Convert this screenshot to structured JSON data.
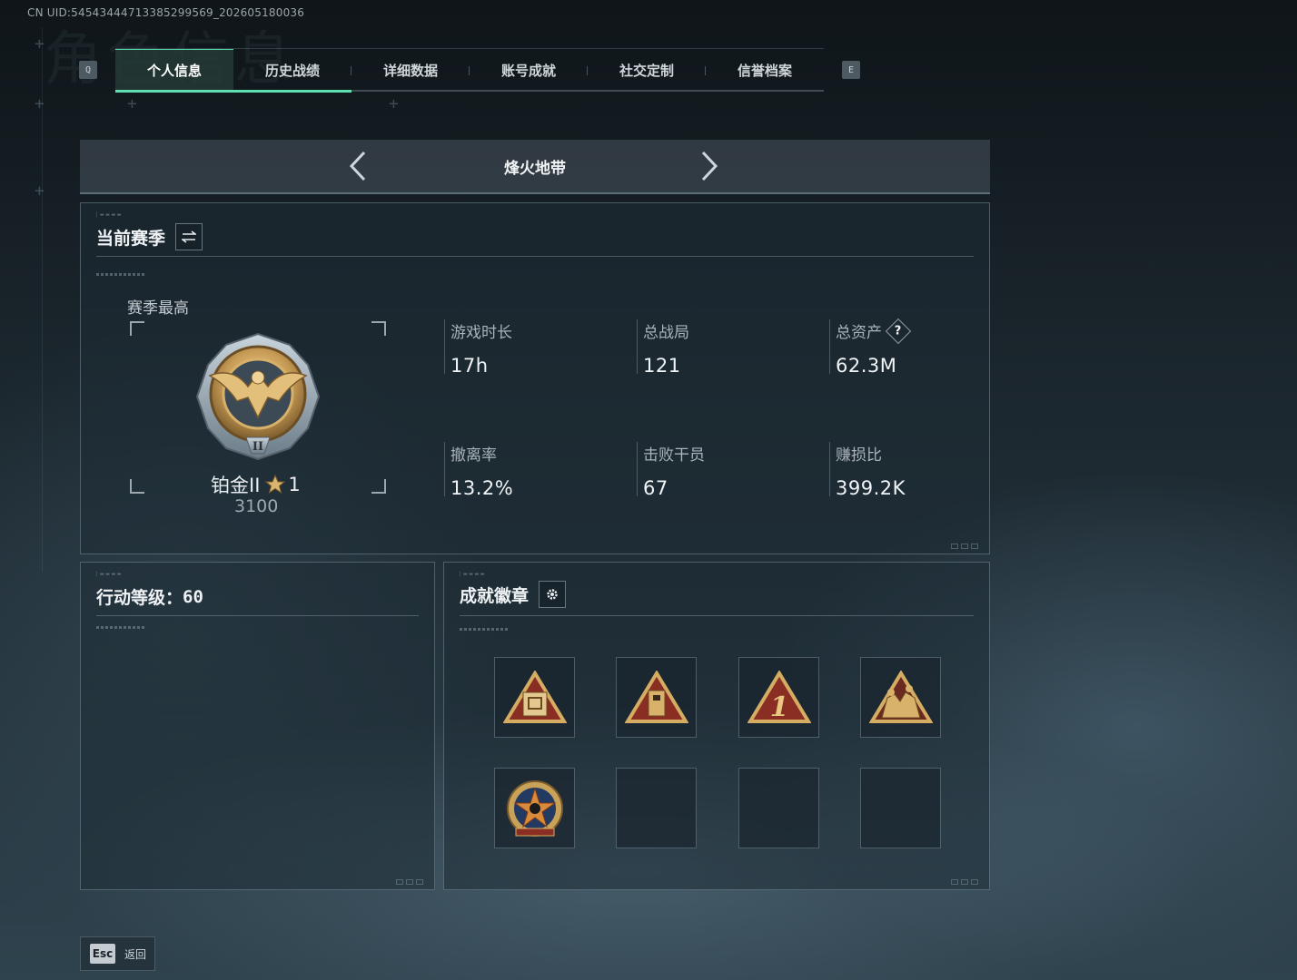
{
  "uid": "CN UID:54543444713385299569_202605180036",
  "background_title": "角色信息",
  "tabs": {
    "left_key": "Q",
    "right_key": "E",
    "items": [
      {
        "label": "个人信息"
      },
      {
        "label": "历史战绩"
      },
      {
        "label": "详细数据"
      },
      {
        "label": "账号成就"
      },
      {
        "label": "社交定制"
      },
      {
        "label": "信誉档案"
      }
    ]
  },
  "mode": {
    "title": "烽火地带"
  },
  "season": {
    "title": "当前赛季",
    "best_label": "赛季最高",
    "rank": "铂金II",
    "stars": "1",
    "score": "3100",
    "stats": [
      {
        "label": "游戏时长",
        "value": "17h"
      },
      {
        "label": "总战局",
        "value": "121"
      },
      {
        "label": "总资产",
        "value": "62.3M"
      },
      {
        "label": "撤离率",
        "value": "13.2%"
      },
      {
        "label": "击败干员",
        "value": "67"
      },
      {
        "label": "赚损比",
        "value": "399.2K"
      }
    ],
    "help_icon": "?"
  },
  "level": {
    "title": "行动等级：",
    "value": "60"
  },
  "badges": {
    "title": "成就徽章",
    "slots_filled": 5,
    "slots_total": 8
  },
  "footer": {
    "esc_key": "Esc",
    "back_label": "返回"
  },
  "colors": {
    "accent": "#5fe0b0",
    "gold": "#c9a25a"
  }
}
